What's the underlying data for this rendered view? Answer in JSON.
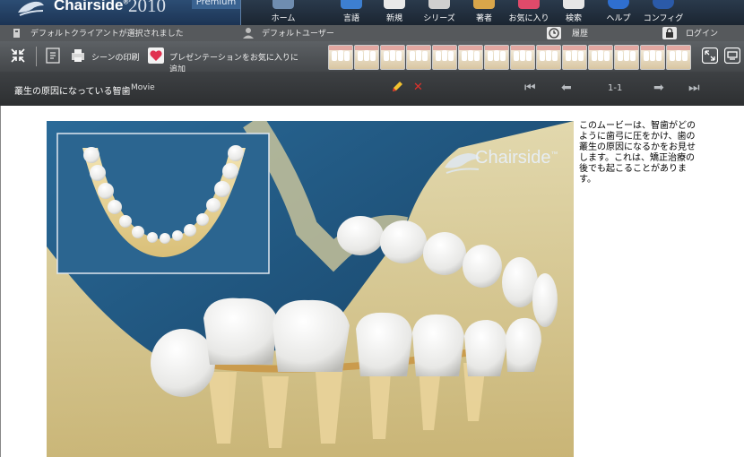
{
  "app": {
    "brand_name": "Chairside",
    "brand_mark": "®",
    "brand_year": "2010",
    "brand_tag": "Premium"
  },
  "colors": {
    "accent_blue": "#1d4f78",
    "bone": "#e7d49a",
    "tooth": "#f4f4f2",
    "delete_red": "#e0312b",
    "edit_yellow": "#f2c230"
  },
  "main_nav": [
    {
      "label": "ホーム",
      "icon": "home-icon"
    },
    {
      "label": "言語",
      "icon": "language-icon"
    },
    {
      "label": "新規",
      "icon": "new-icon"
    },
    {
      "label": "シリーズ",
      "icon": "series-icon"
    },
    {
      "label": "著者",
      "icon": "author-icon"
    },
    {
      "label": "お気に入り",
      "icon": "favorites-icon"
    },
    {
      "label": "検索",
      "icon": "search-icon"
    },
    {
      "label": "ヘルプ",
      "icon": "help-icon"
    },
    {
      "label": "コンフィグ",
      "icon": "config-icon"
    }
  ],
  "statusbar": {
    "client": "デフォルトクライアントが選択されました",
    "user": "デフォルトユーザー",
    "history": "履歴",
    "login": "ログイン"
  },
  "toolbar": {
    "print_scene": "シーンの印刷",
    "add_to_favorites": "プレゼンテーションをお気に入りに追加",
    "thumbnail_count": 14
  },
  "movie": {
    "title": "叢生の原因になっている智歯",
    "type": "Movie",
    "pager": "1-1",
    "description": "このムービーは、智歯がどのように歯弓に圧をかけ、歯の叢生の原因になるかをお見せします。これは、矯正治療の後でも起こることがあります。",
    "watermark": "Chairside",
    "watermark_mark": "™"
  }
}
